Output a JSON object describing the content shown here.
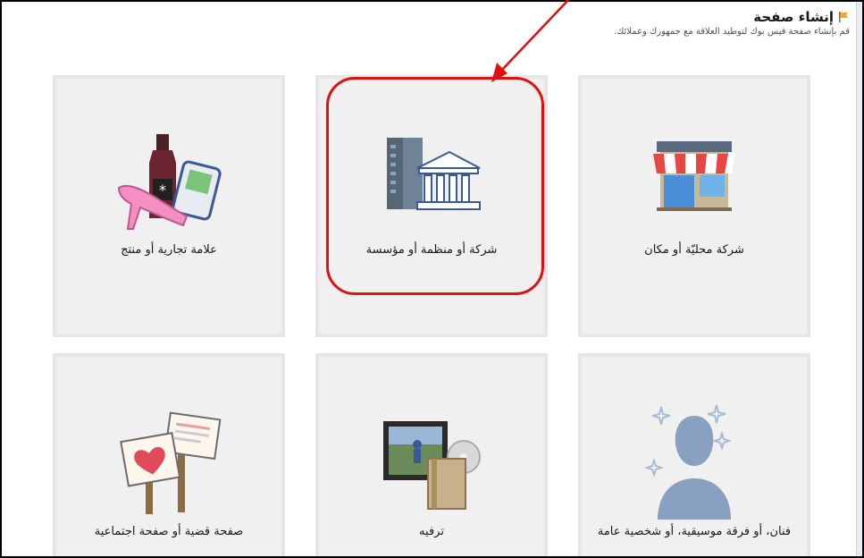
{
  "header": {
    "title": "إنشاء صفحة",
    "subtitle": "قم بإنشاء صفحة فيس بوك لتوطيد العلاقة مع جمهورك وعملائك."
  },
  "categories": [
    {
      "id": "local",
      "label": "شركة محليّة أو مكان",
      "icon": "storefront-icon"
    },
    {
      "id": "company",
      "label": "شركة أو منظمة أو مؤسسة",
      "icon": "company-buildings-icon"
    },
    {
      "id": "brand",
      "label": "علامة تجارية أو منتج",
      "icon": "brand-products-icon"
    },
    {
      "id": "artist",
      "label": "فنان، أو فرقة موسيقية، أو شخصية عامة",
      "icon": "public-figure-icon"
    },
    {
      "id": "entertainment",
      "label": "ترفيه",
      "icon": "entertainment-icon"
    },
    {
      "id": "cause",
      "label": "صفحة قضية أو صفحة اجتماعية",
      "icon": "cause-signs-icon"
    }
  ],
  "annotation": {
    "color": "#e01010",
    "highlighted_category": "company"
  }
}
